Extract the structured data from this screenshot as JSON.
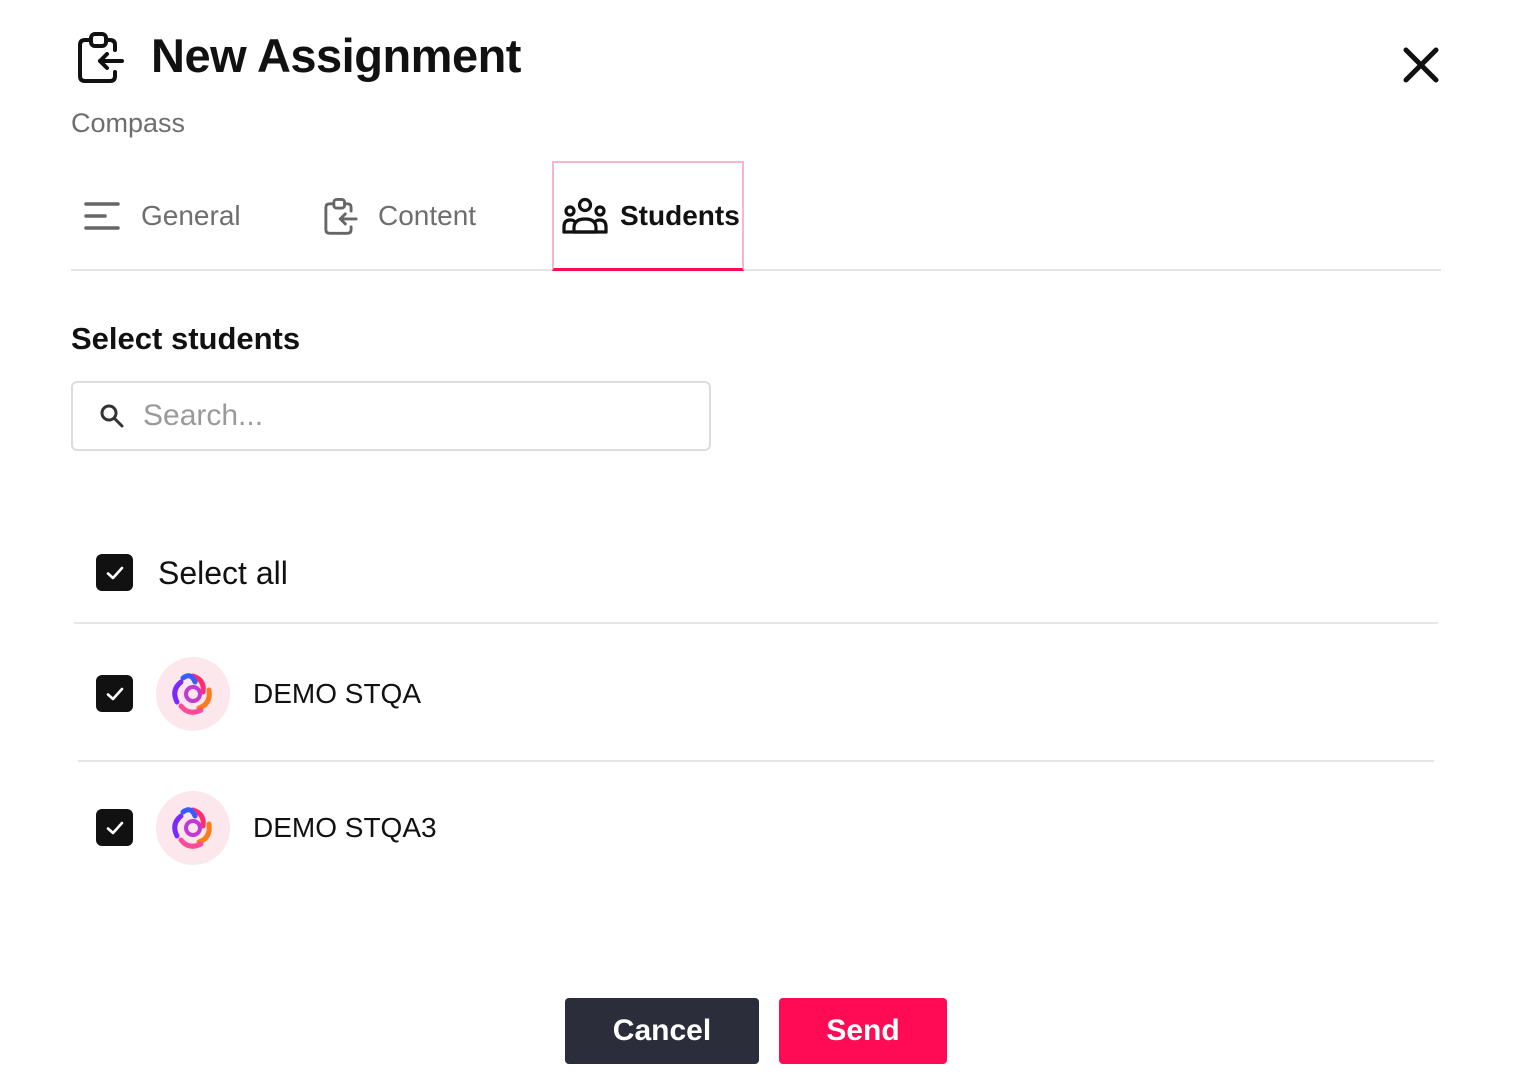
{
  "header": {
    "title": "New Assignment",
    "subtitle": "Compass",
    "title_icon": "clipboard-return-icon",
    "close_icon": "close-icon"
  },
  "tabs": [
    {
      "label": "General",
      "icon": "lines-icon",
      "active": false
    },
    {
      "label": "Content",
      "icon": "clipboard-return-icon",
      "active": false
    },
    {
      "label": "Students",
      "icon": "users-group-icon",
      "active": true
    }
  ],
  "students_section": {
    "title": "Select students",
    "search": {
      "placeholder": "Search...",
      "value": "",
      "icon": "search-icon"
    },
    "select_all": {
      "label": "Select all",
      "checked": true
    },
    "students": [
      {
        "name": "DEMO STQA",
        "checked": true,
        "avatar": "swirl-logo-icon"
      },
      {
        "name": "DEMO STQA3",
        "checked": true,
        "avatar": "swirl-logo-icon"
      }
    ]
  },
  "footer": {
    "cancel_label": "Cancel",
    "send_label": "Send"
  },
  "colors": {
    "accent": "#ff0b55",
    "dark_button": "#2b2d3a",
    "tab_highlight_border": "#f7b6cd",
    "muted_text": "#6e6e6e"
  }
}
